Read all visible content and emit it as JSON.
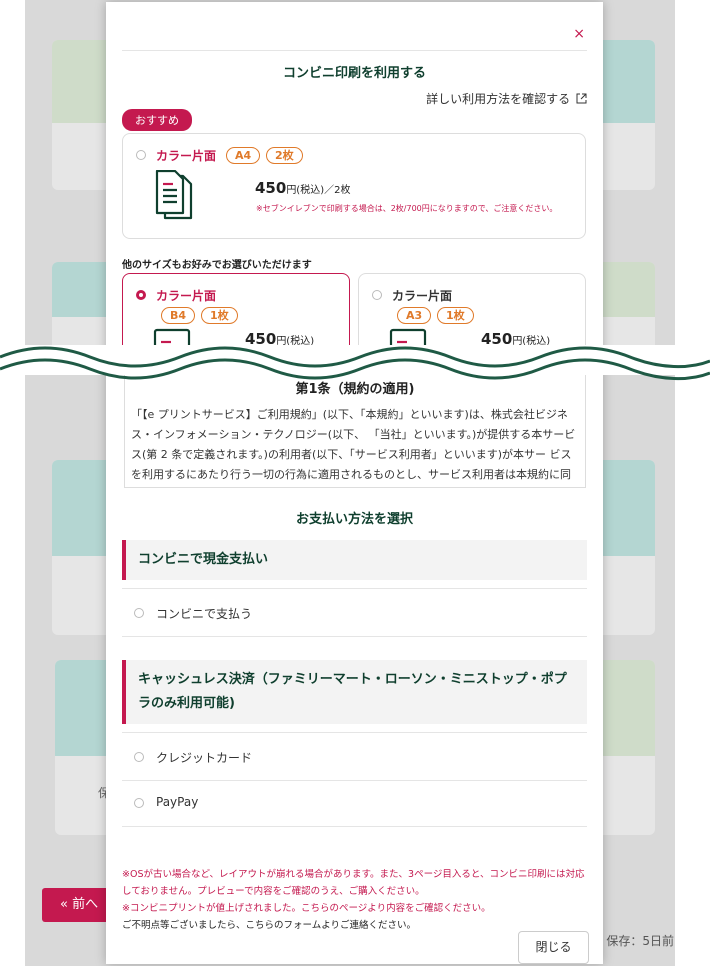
{
  "background": {
    "prev_button": "« 前へ",
    "storage_text": "保存：5日前",
    "fragment_char": "保"
  },
  "modal": {
    "close": "×",
    "title": "コンビニ印刷を利用する",
    "details_link": "詳しい利用方法を確認する",
    "recommended_badge": "おすすめ",
    "recommended": {
      "label": "カラー片面",
      "tags": [
        "A4",
        "2枚"
      ],
      "price": "450",
      "price_unit": "円(税込)／2枚",
      "note": "※セブンイレブンで印刷する場合は、2枚/700円になりますので、ご注意ください。"
    },
    "other_sizes_label": "他のサイズもお好みでお選びいただけます",
    "options": [
      {
        "label": "カラー片面",
        "tags": [
          "B4",
          "1枚"
        ],
        "price": "450",
        "price_unit": "円(税込)",
        "selected": true
      },
      {
        "label": "カラー片面",
        "tags": [
          "A3",
          "1枚"
        ],
        "price": "450",
        "price_unit": "円(税込)",
        "selected": false
      }
    ],
    "terms": {
      "heading": "第1条（規約の適用)",
      "body": "「【e プリントサービス】ご利用規約」(以下、「本規約」といいます)は、株式会社ビジネス・インフォメーション・テクノロジー(以下、 「当社」といいます。)が提供する本サービス(第 2 条で定義されます。)の利用者(以下、「サービス利用者」といいます)が本サー ビスを利用するにあたり行う一切の行為に適用されるものとし、サービス利用者は本規約に同意の上、本サービスを利用するものとします。"
    },
    "payment_title": "お支払い方法を選択",
    "payment_sections": [
      {
        "heading": "コンビニで現金支払い",
        "options": [
          "コンビニで支払う"
        ]
      },
      {
        "heading": "キャッシュレス決済（ファミリーマート・ローソン・ミニストップ・ポプラのみ利用可能)",
        "options": [
          "クレジットカード",
          "PayPay"
        ]
      }
    ],
    "footer": {
      "note1": "※OSが古い場合など、レイアウトが崩れる場合があります。また、3ページ目入ると、コンビニ印刷には対応しておりません。プレビューで内容をご確認のうえ、ご購入ください。",
      "note2": "※コンビニプリントが値上げされました。こちらのページより内容をご確認ください。",
      "note3": "ご不明点等ございましたら、こちらのフォームよりご連絡ください。",
      "close_button": "閉じる"
    }
  },
  "colors": {
    "accent": "#c4194f",
    "heading": "#0f3f2e",
    "tag": "#e07a2a"
  }
}
